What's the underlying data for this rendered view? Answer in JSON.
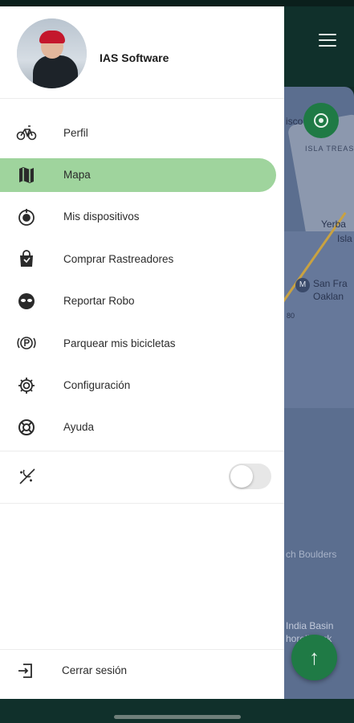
{
  "profile": {
    "name": "IAS Software"
  },
  "menu": {
    "items": [
      {
        "label": "Perfil",
        "icon": "bicycle-icon"
      },
      {
        "label": "Mapa",
        "icon": "map-icon",
        "active": true
      },
      {
        "label": "Mis dispositivos",
        "icon": "device-icon"
      },
      {
        "label": "Comprar Rastreadores",
        "icon": "shopping-bag-icon"
      },
      {
        "label": "Reportar Robo",
        "icon": "mask-icon"
      },
      {
        "label": "Parquear mis bicicletas",
        "icon": "parking-icon"
      },
      {
        "label": "Configuración",
        "icon": "gear-icon"
      },
      {
        "label": "Ayuda",
        "icon": "lifebuoy-icon"
      }
    ]
  },
  "toggle": {
    "icon": "night-mode-icon",
    "on": false
  },
  "logout": {
    "label": "Cerrar sesión",
    "icon": "logout-icon"
  },
  "map": {
    "labels": {
      "top": "isco",
      "island": "ISLA TREAS",
      "yerba": "Yerba",
      "isla": "Isla",
      "sanfra": "San Fra",
      "oakland": "Oaklan",
      "highway": "80",
      "boulders": "ch Boulders",
      "indiabasin": "India Basin",
      "shoreline": "horeli  Park"
    }
  },
  "colors": {
    "accent": "#1f7a45",
    "active_item": "#9fd49d",
    "appbar": "#10302b"
  }
}
